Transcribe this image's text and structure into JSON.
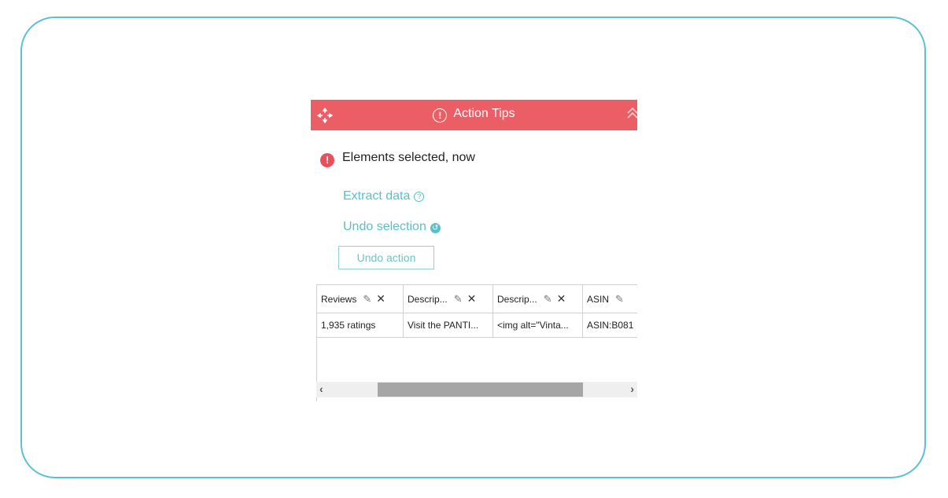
{
  "panel": {
    "title": "Action Tips",
    "icons": {
      "move": "move-icon",
      "title": "exclamation-circle-icon",
      "collapse": "double-chevron-up-icon"
    }
  },
  "message": {
    "text": "Elements selected, now",
    "icon": "alert-icon",
    "icon_glyph": "!"
  },
  "actions": [
    {
      "label": "Extract data",
      "icon": "help-icon",
      "glyph": "?"
    },
    {
      "label": "Undo selection",
      "icon": "undo-icon",
      "glyph": "↺"
    }
  ],
  "undo_button": {
    "label": "Undo action"
  },
  "table": {
    "columns": [
      {
        "label": "Reviews",
        "edit": true,
        "remove": true
      },
      {
        "label": "Descrip...",
        "edit": true,
        "remove": true
      },
      {
        "label": "Descrip...",
        "edit": true,
        "remove": true
      },
      {
        "label": "ASIN",
        "edit": true,
        "remove": false
      }
    ],
    "rows": [
      [
        "1,935 ratings",
        "Visit the PANTI...",
        "<img alt=\"Vinta...",
        "ASIN:B081"
      ]
    ],
    "edit_glyph": "✎",
    "remove_glyph": "✕"
  },
  "scrollbar": {
    "left_arrow": "‹",
    "right_arrow": "›",
    "thumb_start_fraction": 0.19,
    "thumb_end_fraction": 0.83
  },
  "colors": {
    "header": "#ec5e66",
    "accent": "#5bbfc8",
    "frame": "#5bc0d3",
    "alert": "#e8505c"
  }
}
